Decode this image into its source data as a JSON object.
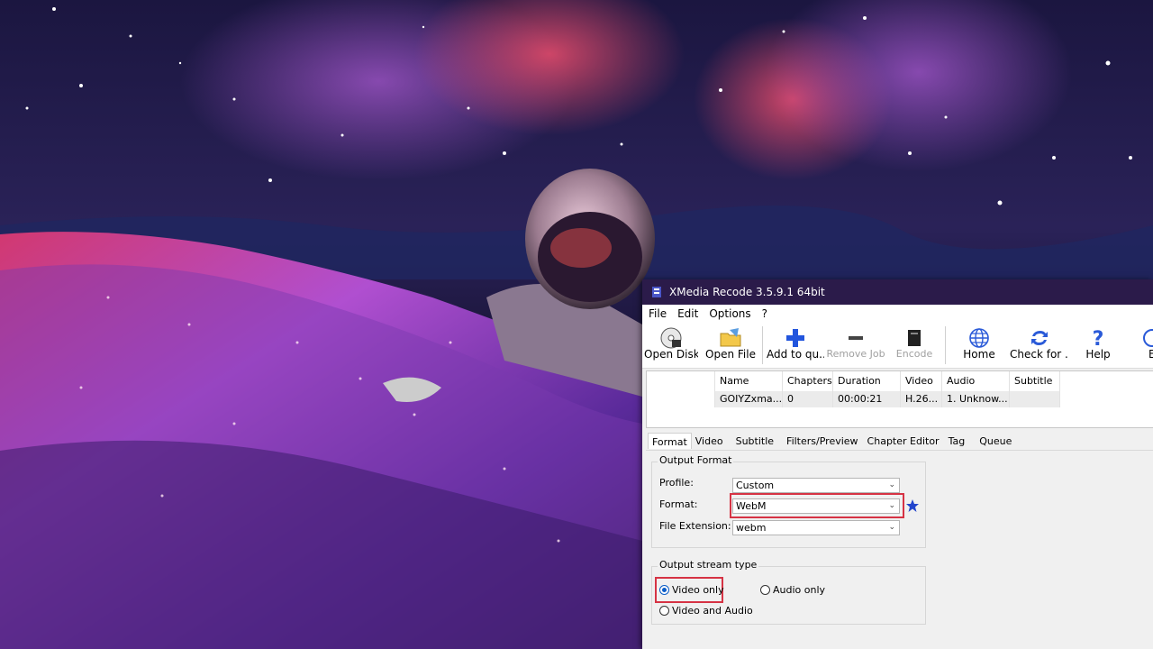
{
  "window": {
    "title": "XMedia Recode 3.5.9.1 64bit"
  },
  "menu": [
    "File",
    "Edit",
    "Options",
    "?"
  ],
  "toolbar": {
    "open_disk": "Open Disk",
    "open_file": "Open File",
    "add_to_queue": "Add to qu...",
    "remove_job": "Remove Job",
    "encode": "Encode",
    "home": "Home",
    "check_for": "Check for ...",
    "help": "Help",
    "partial": "E"
  },
  "file_list": {
    "columns": [
      "Name",
      "Chapters",
      "Duration",
      "Video",
      "Audio",
      "Subtitle"
    ],
    "rows": [
      {
        "name": "GOIYZxma...",
        "chapters": "0",
        "duration": "00:00:21",
        "video": "H.26...",
        "audio": "1. Unknow...",
        "subtitle": ""
      }
    ]
  },
  "tabs": [
    "Format",
    "Video",
    "Subtitle",
    "Filters/Preview",
    "Chapter Editor",
    "Tag",
    "Queue"
  ],
  "active_tab": "Format",
  "output_format": {
    "group_title": "Output Format",
    "profile_label": "Profile:",
    "profile_value": "Custom",
    "format_label": "Format:",
    "format_value": "WebM",
    "extension_label": "File Extension:",
    "extension_value": "webm"
  },
  "output_stream": {
    "group_title": "Output stream type",
    "options": [
      "Video only",
      "Audio only",
      "Video and Audio"
    ],
    "selected": "Video only"
  },
  "colors": {
    "highlight": "#d63344",
    "titlebar": "#2b1b4a",
    "accent_blue": "#2255dd"
  }
}
